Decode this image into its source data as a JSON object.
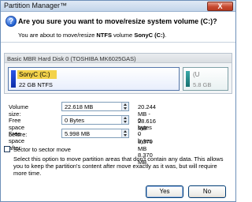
{
  "window": {
    "title": "Partition Manager™",
    "close_label": "X"
  },
  "header": {
    "question_icon": "question-icon",
    "title": "Are you sure you want to move/resize system volume (C:)?",
    "subtitle_pre": "You are about to move/resize ",
    "subtitle_fs": "NTFS",
    "subtitle_mid": " volume ",
    "subtitle_vol": "SonyC (C:)",
    "subtitle_end": "."
  },
  "disk": {
    "label": "Basic MBR Hard Disk 0 (TOSHIBA MK6025GAS)",
    "partitions": [
      {
        "name": "SonyC (C:)",
        "info": "22 GB NTFS",
        "color": "#1a3fd0"
      },
      {
        "name": "(U",
        "info": "5.8 GB",
        "color": "#2a8f8d"
      }
    ]
  },
  "form": {
    "volume_size": {
      "label": "Volume size:",
      "value": "22.618 MB",
      "range": "20.244 MB - 28.616 MB"
    },
    "free_before": {
      "label": "Free space before:",
      "value": "0 Bytes",
      "range": "0 bytes - 8.370 MB"
    },
    "free_after": {
      "label": "Free space after:",
      "value": "5.998 MB",
      "range": "0 bytes - 8.370 MB"
    }
  },
  "sector": {
    "label": "Sector to sector move",
    "checked": false,
    "description": "Select this option to move partition areas that don't contain any data. This allows you to keep the partition's content after move exactly as it was, but will require more time."
  },
  "buttons": {
    "yes": "Yes",
    "no": "No"
  }
}
